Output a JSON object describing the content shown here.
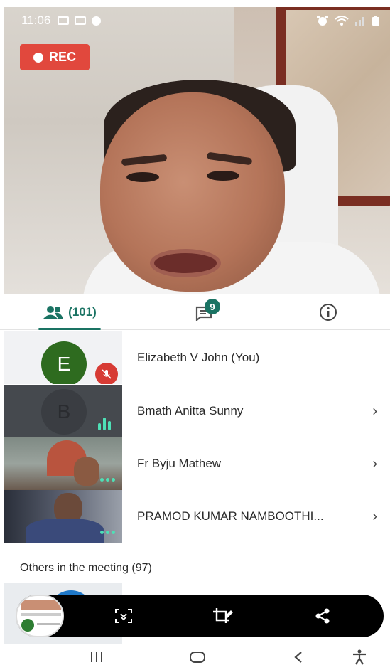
{
  "status_bar": {
    "time": "11:06",
    "left_icons": [
      "image-icon",
      "keyboard-icon",
      "chat-bubble-icon"
    ],
    "right_icons": [
      "alarm-icon",
      "wifi-icon",
      "signal-icon",
      "battery-icon"
    ]
  },
  "video": {
    "rec_label": "REC",
    "rec_color": "#e1483d"
  },
  "tabs": {
    "people_count": "(101)",
    "chat_badge": "9",
    "active_color": "#1a7363"
  },
  "participants": [
    {
      "name": "Elizabeth V John (You)",
      "avatar_letter": "E",
      "avatar_color": "#2e6b1f",
      "muted": true,
      "has_chevron": false
    },
    {
      "name": "Bmath Anitta Sunny",
      "avatar_letter": "B",
      "avatar_color": "#3a3d42",
      "speaking": true,
      "has_chevron": true
    },
    {
      "name": "Fr Byju Mathew",
      "video": true,
      "has_chevron": true
    },
    {
      "name": "PRAMOD KUMAR NAMBOOTHI...",
      "video": true,
      "has_chevron": true
    }
  ],
  "others": {
    "label": "Others in the meeting (97)"
  },
  "screenshot_toolbar": {
    "buttons": [
      "scroll-capture-icon",
      "crop-edit-icon",
      "share-icon"
    ]
  },
  "navbar": {
    "buttons": [
      "recent-apps-icon",
      "home-icon",
      "back-icon",
      "accessibility-icon"
    ]
  }
}
